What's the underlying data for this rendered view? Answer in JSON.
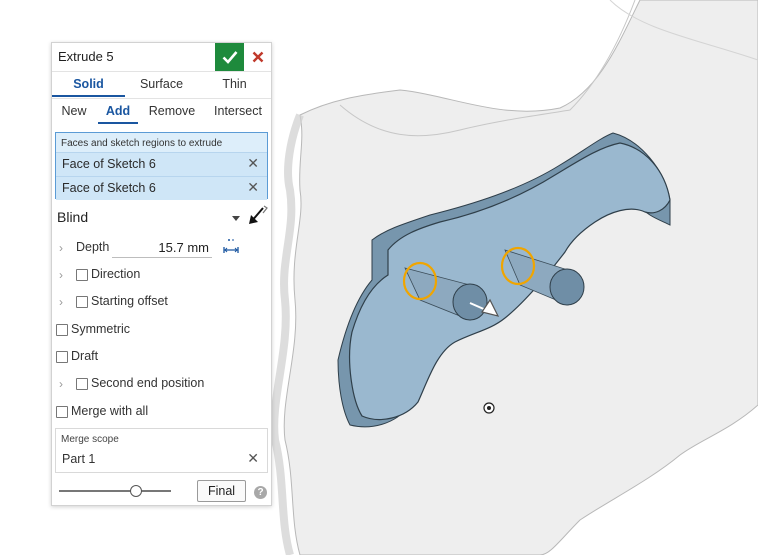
{
  "dialog": {
    "title": "Extrude 5",
    "tabs_type": [
      "Solid",
      "Surface",
      "Thin"
    ],
    "tabs_operation": [
      "New",
      "Add",
      "Remove",
      "Intersect"
    ],
    "faces_label": "Faces and sketch regions to extrude",
    "faces": [
      "Face of Sketch 6",
      "Face of Sketch 6"
    ],
    "end_type": "Blind",
    "depth_label": "Depth",
    "depth_value": "15.7 mm",
    "direction_label": "Direction",
    "starting_offset_label": "Starting offset",
    "symmetric_label": "Symmetric",
    "draft_label": "Draft",
    "second_end_label": "Second end position",
    "merge_with_all_label": "Merge with all",
    "merge_scope_label": "Merge scope",
    "merge_scope_value": "Part 1",
    "slider_value": 0.68,
    "final_label": "Final",
    "help_label": "?"
  },
  "colors": {
    "accent": "#1a56a0",
    "ok": "#1e8a3c",
    "cancel": "#c0392b",
    "part_face": "#9ab8cf",
    "part_side": "#7796ad",
    "highlight": "#f0a500"
  }
}
